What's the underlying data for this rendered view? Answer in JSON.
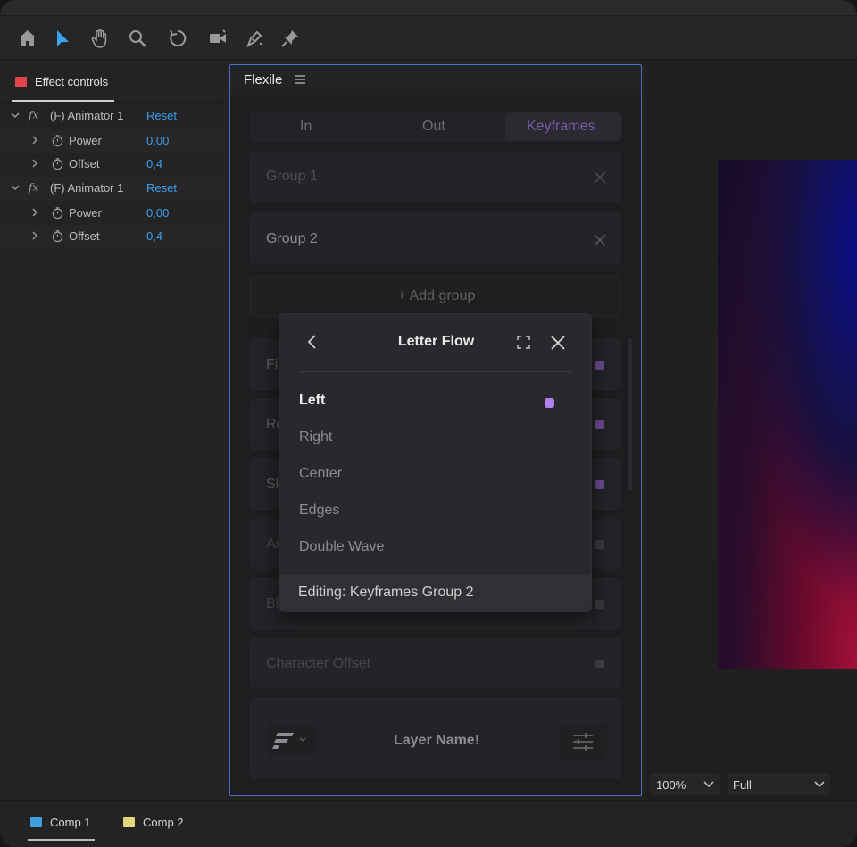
{
  "toolbar": {
    "tools": [
      "home-icon",
      "selection-arrow-icon",
      "hand-icon",
      "zoom-icon",
      "rotate-icon",
      "camera-icon",
      "pen-icon",
      "pin-icon"
    ],
    "active_tool": "selection-arrow-icon",
    "active_color": "#3aa3f5"
  },
  "effect_controls": {
    "tab_label": "Effect controls",
    "tab_color": "#e0454a",
    "rows": [
      {
        "type": "group",
        "label": "(F) Animator 1",
        "value": "Reset"
      },
      {
        "type": "prop",
        "label": "Power",
        "value": "0,00"
      },
      {
        "type": "prop",
        "label": "Offset",
        "value": "0,4"
      },
      {
        "type": "group",
        "label": "(F) Animator 1",
        "value": "Reset"
      },
      {
        "type": "prop",
        "label": "Power",
        "value": "0,00"
      },
      {
        "type": "prop",
        "label": "Offset",
        "value": "0,4"
      }
    ]
  },
  "plugin": {
    "title": "Flexile",
    "tabs": [
      "In",
      "Out",
      "Keyframes"
    ],
    "active_tab": "Keyframes",
    "groups": [
      "Group 1",
      "Group 2"
    ],
    "add_group": "+ Add group",
    "hidden_rows": [
      "Fi",
      "Ro",
      "Sk",
      "Ar",
      "Bl"
    ],
    "character_offset": "Character Offset",
    "layer_name": "Layer Name!"
  },
  "popup": {
    "title": "Letter Flow",
    "options": [
      "Left",
      "Right",
      "Center",
      "Edges",
      "Double Wave"
    ],
    "selected": "Left",
    "footer": "Editing: Keyframes Group 2",
    "accent": "#b27ff0"
  },
  "viewer": {
    "zoom": "100%",
    "quality": "Full"
  },
  "comps": [
    {
      "label": "Comp 1",
      "color": "#3d9ee0"
    },
    {
      "label": "Comp 2",
      "color": "#e4d67a"
    }
  ]
}
